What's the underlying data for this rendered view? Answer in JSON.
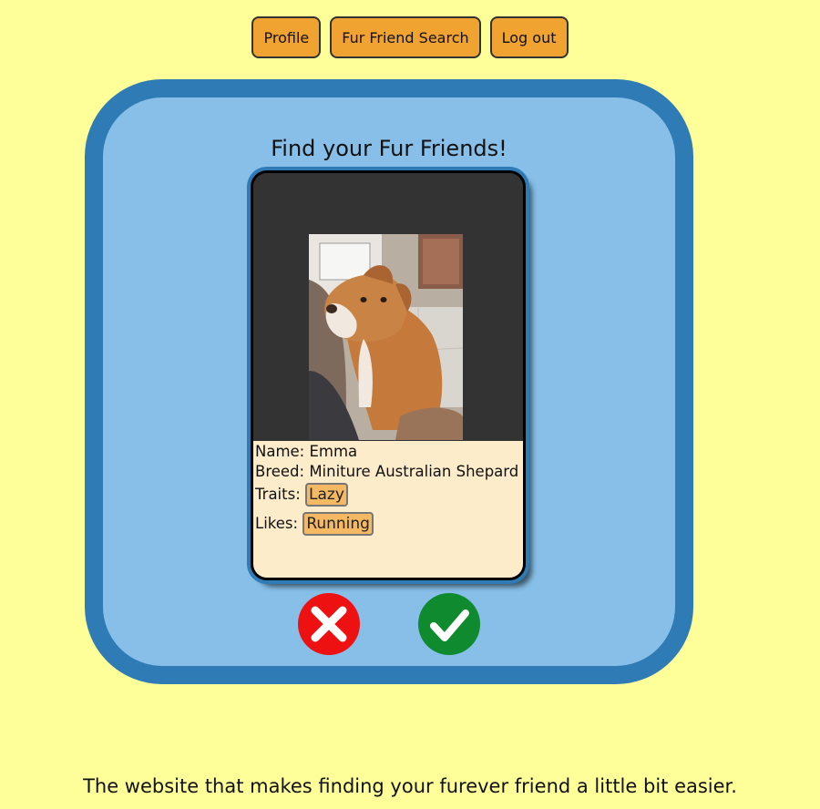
{
  "nav": {
    "profile_label": "Profile",
    "search_label": "Fur Friend Search",
    "logout_label": "Log out"
  },
  "panel": {
    "title": "Find your Fur Friends!"
  },
  "card": {
    "photo_icon": "dog-photo",
    "name_line": "Name: Emma",
    "breed_line": "Breed: Miniture Australian Shepard",
    "traits_label": "Traits:",
    "traits": [
      "Lazy"
    ],
    "likes_label": "Likes:",
    "likes": [
      "Running"
    ]
  },
  "actions": {
    "reject_icon": "close-icon",
    "accept_icon": "check-icon",
    "reject_color": "#ee1111",
    "accept_color": "#0f8a2f"
  },
  "footer": {
    "tagline": "The website that makes finding your furever friend a little bit easier."
  },
  "colors": {
    "page_bg": "#ffff99",
    "panel_bg": "#87bfe8",
    "panel_border": "#2e7bb6",
    "button_bg": "#f0a331",
    "card_info_bg": "#fdecca",
    "chip_bg": "#f4b962"
  }
}
